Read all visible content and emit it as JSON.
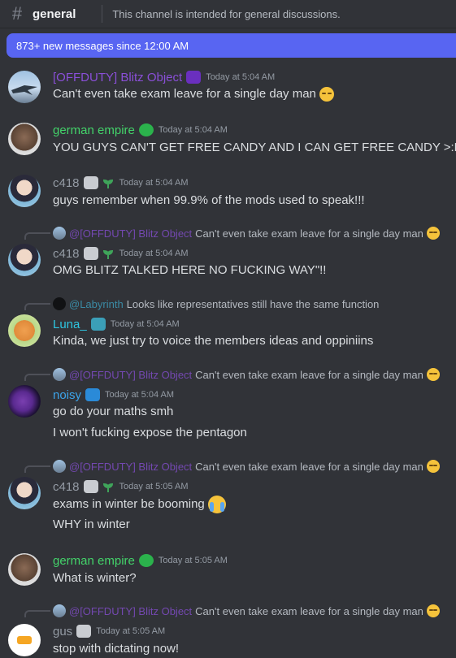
{
  "header": {
    "channel_name": "general",
    "topic": "This channel is intended for general discussions."
  },
  "banner": {
    "text": "873+ new messages since 12:00 AM"
  },
  "colors": {
    "background": "#313338",
    "accent": "#5865f2",
    "blitz": "#8a4fd8",
    "german": "#43d36a",
    "c418": "#949ba4",
    "labyrinth": "#3ea7c8",
    "luna": "#2ec5e0",
    "noisy": "#3ca4ea",
    "gus": "#949ba4"
  },
  "messages": [
    {
      "author": "[OFFDUTY] Blitz Object",
      "timestamp": "Today at 5:04 AM",
      "lines": [
        "Can't even take exam leave for a single day man"
      ]
    },
    {
      "author": "german empire",
      "timestamp": "Today at 5:04 AM",
      "lines": [
        "YOU GUYS CAN'T GET FREE CANDY AND I CAN GET FREE CANDY >:D"
      ]
    },
    {
      "author": "c418",
      "timestamp": "Today at 5:04 AM",
      "lines": [
        "guys remember when 99.9% of the mods used to speak!!!"
      ]
    },
    {
      "reply": {
        "author": "@[OFFDUTY] Blitz Object",
        "text": "Can't even take exam leave for a single day man"
      },
      "author": "c418",
      "timestamp": "Today at 5:04 AM",
      "lines": [
        "OMG BLITZ TALKED HERE NO FUCKING WAY\"!!"
      ]
    },
    {
      "reply": {
        "author": "@Labyrinth",
        "text": "Looks like representatives still have the same function"
      },
      "author": "Luna_",
      "timestamp": "Today at 5:04 AM",
      "lines": [
        "Kinda, we just try to voice the members ideas and oppiniins"
      ]
    },
    {
      "reply": {
        "author": "@[OFFDUTY] Blitz Object",
        "text": "Can't even take exam leave for a single day man"
      },
      "author": "noisy",
      "timestamp": "Today at 5:04 AM",
      "lines": [
        "go do your maths smh",
        "I won't fucking expose the pentagon"
      ]
    },
    {
      "reply": {
        "author": "@[OFFDUTY] Blitz Object",
        "text": "Can't even take exam leave for a single day man"
      },
      "author": "c418",
      "timestamp": "Today at 5:05 AM",
      "lines": [
        "exams in winter be booming",
        "WHY in winter"
      ]
    },
    {
      "author": "german empire",
      "timestamp": "Today at 5:05 AM",
      "lines": [
        "What is winter?"
      ]
    },
    {
      "reply": {
        "author": "@[OFFDUTY] Blitz Object",
        "text": "Can't even take exam leave for a single day man"
      },
      "author": "gus",
      "timestamp": "Today at 5:05 AM",
      "lines": [
        "stop with dictating now!"
      ]
    }
  ]
}
